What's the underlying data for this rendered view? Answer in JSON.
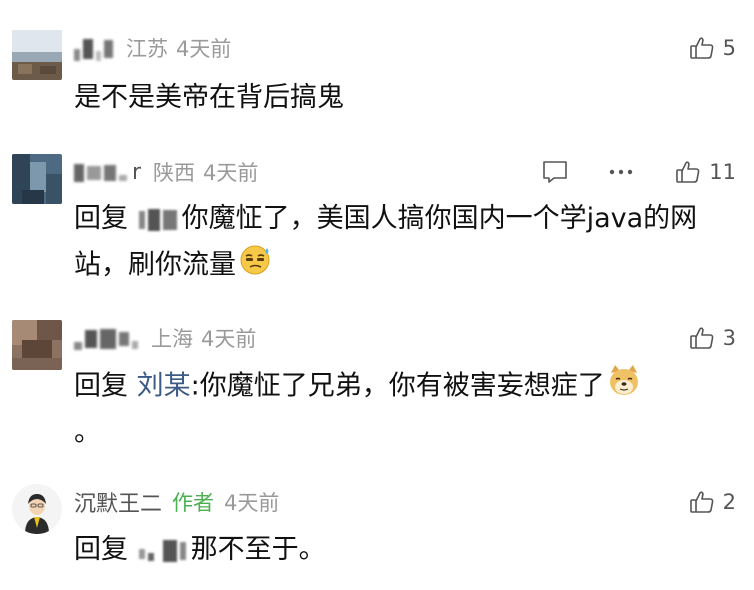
{
  "comments": [
    {
      "location": "江苏",
      "time": "4天前",
      "likes": "5",
      "text": "是不是美帝在背后搞鬼"
    },
    {
      "name_partial": "r",
      "location": "陕西",
      "time": "4天前",
      "likes": "11",
      "reply_label": "回复",
      "text": "你魔怔了，美国人搞你国内一个学java的网站，刷你流量",
      "emoji": "smirk-sweat-emoji"
    },
    {
      "location": "上海",
      "time": "4天前",
      "likes": "3",
      "reply_label": "回复",
      "reply_target": "刘某",
      "text": "你魔怔了兄弟，你有被害妄想症了",
      "trailing": "。",
      "emoji": "doge-emoji"
    },
    {
      "name": "沉默王二",
      "author_tag": "作者",
      "time": "4天前",
      "likes": "2",
      "reply_label": "回复",
      "text": "那不至于。"
    }
  ],
  "colors": {
    "meta_gray": "#9a9a9a",
    "author_green": "#4caf50",
    "reply_blue": "#3b5a86",
    "text": "#111111"
  }
}
